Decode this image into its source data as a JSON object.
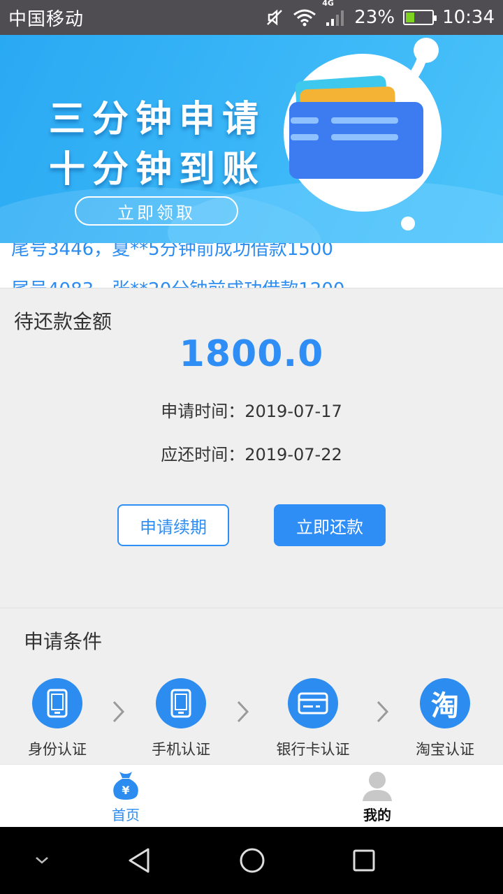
{
  "status_bar": {
    "carrier": "中国移动",
    "network": "4G",
    "battery": "23%",
    "time": "10:34"
  },
  "banner": {
    "line1": "三分钟申请",
    "line2": "十分钟到账",
    "button": "立即领取"
  },
  "notices": [
    "尾号3446，夏**5分钟前成功借款1500",
    "尾号4083，张**20分钟前成功借款1200"
  ],
  "repayment": {
    "title": "待还款金额",
    "amount": "1800.0",
    "apply_label": "申请时间：",
    "apply_date": "2019-07-17",
    "due_label": "应还时间：",
    "due_date": "2019-07-22",
    "renew_button": "申请续期",
    "repay_button": "立即还款"
  },
  "conditions": {
    "title": "申请条件",
    "steps": [
      {
        "label": "身份认证",
        "icon": "id-card-icon"
      },
      {
        "label": "手机认证",
        "icon": "phone-icon"
      },
      {
        "label": "银行卡认证",
        "icon": "bank-card-icon"
      },
      {
        "label": "淘宝认证",
        "icon": "taobao-icon",
        "glyph": "淘"
      }
    ]
  },
  "tabs": [
    {
      "label": "首页",
      "icon": "money-bag-icon",
      "active": true
    },
    {
      "label": "我的",
      "icon": "user-avatar-icon",
      "active": false
    }
  ],
  "colors": {
    "accent": "#2f8ef5",
    "banner": "#2aa9f3",
    "status_bar": "#4f4d52"
  }
}
